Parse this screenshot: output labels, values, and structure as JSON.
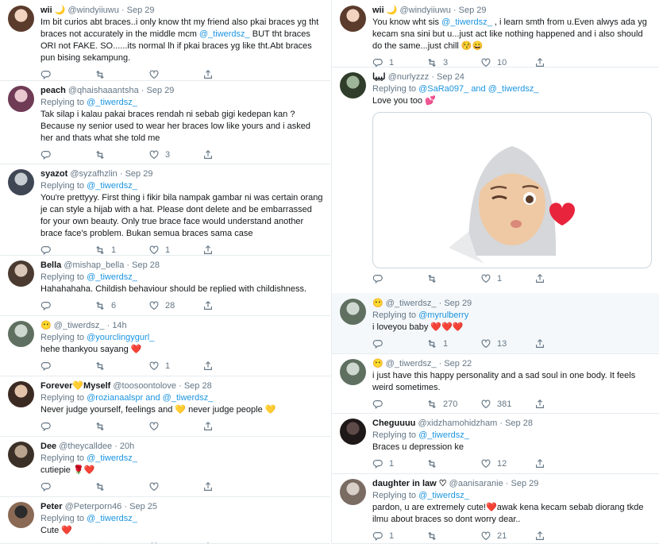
{
  "left": [
    {
      "name": "wii 🌙",
      "handle": "@windyiiuwu",
      "time": "Sep 29",
      "replying": null,
      "text": [
        "Im bit curios abt braces..i only know tht my friend also pkai braces yg tht braces not accurately in the middle mcm ",
        "@_tiwerdsz_",
        " BUT tht braces ORI not FAKE. SO......its normal lh if pkai braces yg like tht.Abt braces pun bising sekampung."
      ],
      "reply_count": "",
      "retweet_count": "",
      "like_count": "",
      "av": [
        "#f0d4c0",
        "#5b3b2c"
      ]
    },
    {
      "name": "peach",
      "handle": "@qhaishaaantsha",
      "time": "Sep 29",
      "replying": "@_tiwerdsz_",
      "text": [
        "Tak silap i kalau pakai braces rendah ni sebab gigi kedepan kan ? Because ny senior used to wear her braces low like yours and i asked her and thats what she told me"
      ],
      "reply_count": "",
      "retweet_count": "",
      "like_count": "3",
      "av": [
        "#e9c9cf",
        "#6f3b55"
      ]
    },
    {
      "name": "syazot",
      "handle": "@syzafhzlin",
      "time": "Sep 29",
      "replying": "@_tiwerdsz_",
      "text": [
        "You're prettyyy. First thing i fikir bila nampak gambar ni was certain orang je can style a hijab with a hat. Please dont delete and be embarrassed for your own beauty. Only true brace face would understand another brace face's problem. Bukan semua braces sama case"
      ],
      "reply_count": "",
      "retweet_count": "1",
      "like_count": "1",
      "av": [
        "#c7ccd3",
        "#3f4654"
      ]
    },
    {
      "name": "Bella",
      "handle": "@mishap_bella",
      "time": "Sep 28",
      "replying": "@_tiwerdsz_",
      "text": [
        "Hahahahaha. Childish behaviour should be replied with childishness."
      ],
      "reply_count": "",
      "retweet_count": "6",
      "like_count": "28",
      "av": [
        "#d9c6b6",
        "#4a3a30"
      ]
    },
    {
      "name": "😶",
      "handle": "@_tiwerdsz_",
      "time": "14h",
      "replying": "@yourclingygurl_",
      "text": [
        "hehe thankyou sayang ",
        "❤️"
      ],
      "reply_count": "",
      "retweet_count": "",
      "like_count": "1",
      "av": [
        "#cfd8d0",
        "#5f7060"
      ]
    },
    {
      "name": "Forever💛Myself",
      "handle": "@toosoontolove",
      "time": "Sep 28",
      "replying": "@rozianaalspr and @_tiwerdsz_",
      "text": [
        "Never judge yourself, feelings and 💛 never judge people 💛"
      ],
      "reply_count": "",
      "retweet_count": "",
      "like_count": "",
      "av": [
        "#e2c3a9",
        "#3b2a22"
      ]
    },
    {
      "name": "Dee",
      "handle": "@theycalldee",
      "time": "20h",
      "replying": "@_tiwerdsz_",
      "text": [
        "cutiepie 🌹❤️"
      ],
      "reply_count": "",
      "retweet_count": "",
      "like_count": "",
      "av": [
        "#b9a48f",
        "#3b3027"
      ]
    },
    {
      "name": "Peter",
      "handle": "@Peterporn46",
      "time": "Sep 25",
      "replying": "@_tiwerdsz_",
      "text": [
        "Cute ",
        "❤️"
      ],
      "reply_count": "",
      "retweet_count": "",
      "like_count": "",
      "av": [
        "#2b2b2b",
        "#8a6a55"
      ]
    }
  ],
  "right": [
    {
      "name": "wii 🌙",
      "handle": "@windyiiuwu",
      "time": "Sep 29",
      "replying": null,
      "text": [
        "You know wht sis ",
        "@_tiwerdsz_",
        " , i learn smth from u.Even alwys ada yg kecam sna sini but u...just act like nothing happened and i also should do the same...just chill 😚😄"
      ],
      "reply_count": "1",
      "retweet_count": "3",
      "like_count": "10",
      "av": [
        "#f0d4c0",
        "#5b3b2c"
      ]
    },
    {
      "name": "ليبيا",
      "handle": "@nurlyzzz",
      "time": "Sep 24",
      "replying": "@SaRa097_ and @_tiwerdsz_",
      "text": [
        "Love you too 💕"
      ],
      "card": true,
      "reply_count": "",
      "retweet_count": "",
      "like_count": "1",
      "av": [
        "#9fb59a",
        "#2f3d2a"
      ]
    },
    {
      "name": "😶",
      "handle": "@_tiwerdsz_",
      "time": "Sep 29",
      "replying": "@myrulberry",
      "text": [
        "i loveyou baby ",
        "❤️❤️❤️"
      ],
      "hl": true,
      "reply_count": "",
      "retweet_count": "1",
      "like_count": "13",
      "av": [
        "#cfd8d0",
        "#5f7060"
      ]
    },
    {
      "name": "😶",
      "handle": "@_tiwerdsz_",
      "time": "Sep 22",
      "replying": null,
      "text": [
        "i just have this happy personality and a sad soul in one body. It feels weird sometimes."
      ],
      "reply_count": "",
      "retweet_count": "270",
      "like_count": "381",
      "av": [
        "#cfd8d0",
        "#5f7060"
      ]
    },
    {
      "name": "Cheguuuu",
      "handle": "@xidzhamohidzham",
      "time": "Sep 28",
      "replying": "@_tiwerdsz_",
      "text": [
        "Braces u depression ke"
      ],
      "reply_count": "1",
      "retweet_count": "",
      "like_count": "12",
      "av": [
        "#5e4a48",
        "#1f1818"
      ]
    },
    {
      "name": "daughter in law ♡",
      "handle": "@aanisaranie",
      "time": "Sep 29",
      "replying": "@_tiwerdsz_",
      "text": [
        "pardon, u are extremely cute!",
        "❤️",
        "awak kena kecam sebab diorang tkde ilmu about braces so dont worry dear.."
      ],
      "reply_count": "1",
      "retweet_count": "",
      "like_count": "21",
      "av": [
        "#d8cfc8",
        "#7a6b63"
      ]
    }
  ],
  "labels": {
    "replying_to": "Replying to",
    "dot": "·"
  },
  "colors": {
    "link": "#1b95e0",
    "muted": "#657786",
    "border": "#e6ecf0",
    "like": "#e0245e"
  }
}
